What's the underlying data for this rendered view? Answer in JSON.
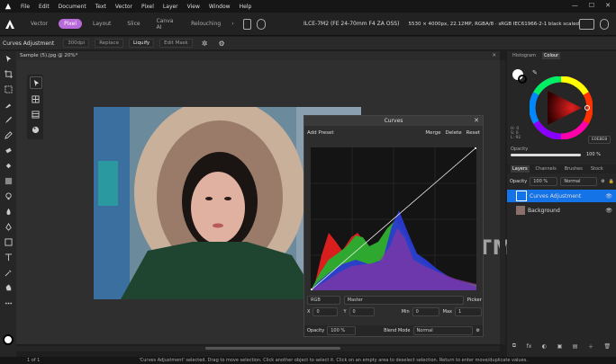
{
  "menubar": {
    "items": [
      "File",
      "Edit",
      "Document",
      "Text",
      "Vector",
      "Pixel",
      "Layer",
      "View",
      "Window",
      "Help"
    ]
  },
  "toolbar": {
    "personas": [
      {
        "label": "Vector",
        "active": false
      },
      {
        "label": "Pixel",
        "active": true
      },
      {
        "label": "Layout",
        "active": false
      },
      {
        "label": "Slice",
        "active": false
      },
      {
        "label": "Canva AI",
        "active": false
      },
      {
        "label": "Relouching",
        "active": false
      }
    ],
    "doc_camera": "ILCE-7M2 (FE 24-70mm F4 ZA OSS)",
    "doc_info": "5530 × 4000px, 22.12MP, RGBA/8 · sRGB IEC61966-2-1 black scaled"
  },
  "context_bar": {
    "title": "Curves Adjustment",
    "buttons": [
      {
        "label": "300dpi",
        "enabled": false
      },
      {
        "label": "Replace",
        "enabled": false
      },
      {
        "label": "Liquify",
        "enabled": true
      },
      {
        "label": "Edit Mask",
        "enabled": false
      }
    ]
  },
  "document_tab": "Sample (5).jpg @ 20%*",
  "curves": {
    "title": "Curves",
    "add_preset": "Add Preset",
    "merge": "Merge",
    "delete": "Delete",
    "reset": "Reset",
    "channel": "RGB",
    "master": "Master",
    "picker": "Picker",
    "x_label": "X",
    "x_value": "0",
    "y_label": "Y",
    "y_value": "0",
    "min_label": "Min",
    "min_value": "0",
    "max_label": "Max",
    "max_value": "1",
    "opacity_label": "Opacity",
    "opacity_value": "100 %",
    "blend_label": "Blend Mode",
    "blend_value": "Normal"
  },
  "color_panel": {
    "tabs": [
      "Histogram",
      "Colour"
    ],
    "active_tab": "Colour",
    "hex": "E0E8E8",
    "h": "H: 0",
    "s": "S: 0",
    "l": "L: 92",
    "opacity_label": "Opacity",
    "opacity_value": "100 %"
  },
  "layers_panel": {
    "tabs": [
      "Layers",
      "Channels",
      "Brushes",
      "Stock"
    ],
    "active_tab": "Layers",
    "opacity_label": "Opacity",
    "opacity_value": "100 %",
    "blend_value": "Normal",
    "layers": [
      {
        "name": "Curves Adjustment",
        "selected": true
      },
      {
        "name": "Background",
        "selected": false
      }
    ]
  },
  "status": {
    "page": "1 of 1",
    "message": "'Curves Adjustment' selected. Drag to move selection. Click another object to select it. Click on an empty area to deselect selection. Return to enter move/duplicate values."
  },
  "watermark": "SOFTMOLA",
  "colors": {
    "accent": "#b86bd8",
    "selection": "#1473e6"
  }
}
